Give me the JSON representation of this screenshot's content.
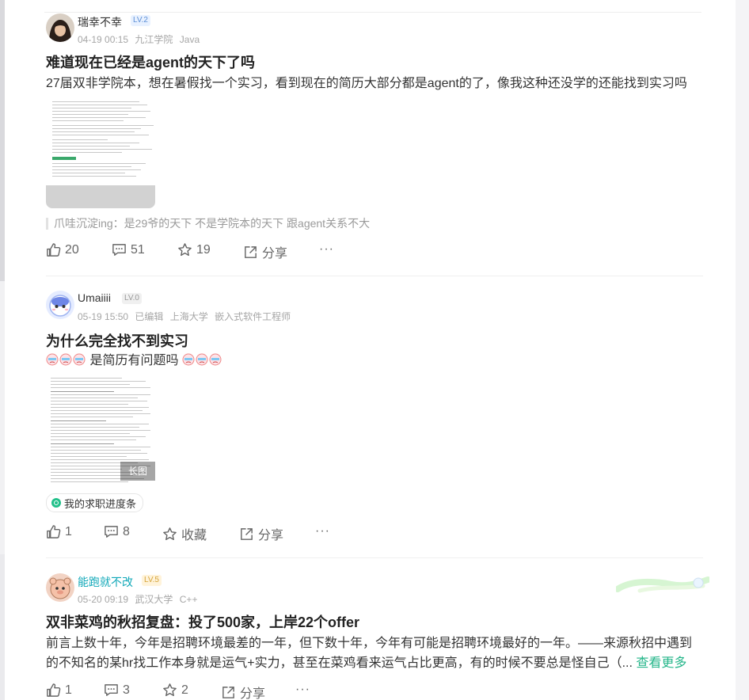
{
  "posts": [
    {
      "username": "瑞幸不幸",
      "level": "LV.2",
      "time": "04-19 00:15",
      "school": "九江学院",
      "job": "Java",
      "title": "难道现在已经是agent的天下了吗",
      "body": "27届双非学院本，想在暑假找一个实习，看到现在的简历大部分都是agent的了，像我这种还没学的还能找到实习吗",
      "comment_preview": "爪哇沉淀ing：是29爷的天下 不是学院本的天下 跟agent关系不大",
      "likes": "20",
      "comments": "51",
      "favorites": "19",
      "share_label": "分享",
      "more": "···"
    },
    {
      "username": "Umaiiii",
      "level": "LV.0",
      "time": "05-19 15:50",
      "edited": "已编辑",
      "school": "上海大学",
      "job": "嵌入式软件工程师",
      "title": "为什么完全找不到实习",
      "body_text": "是简历有问题吗",
      "long_image_label": "长图",
      "tag": "我的求职进度条",
      "likes": "1",
      "comments": "8",
      "favorites_label": "收藏",
      "share_label": "分享",
      "more": "···"
    },
    {
      "username": "能跑就不改",
      "level": "LV.5",
      "time": "05-20 09:19",
      "school": "武汉大学",
      "job": "C++",
      "title": "双非菜鸡的秋招复盘：投了500家，上岸22个offer",
      "body_line1": "前言上数十年，今年是招聘环境最差的一年，但下数十年，今年有可能是招聘环境最好的一年。——来源秋招中遇到",
      "body_line2": "的不知名的某hr找工作本身就是运气+实力，甚至在菜鸡看来运气占比更高，有的时候不要总是怪自己（...",
      "see_more": "查看更多",
      "likes": "1",
      "comments": "3",
      "favorites": "2",
      "share_label": "分享",
      "more": "···"
    }
  ],
  "colors": {
    "accent_green": "#25b68a",
    "level_blue": "#5c8fd6",
    "level_gold": "#d5a43a",
    "special_username": "#11a8b8"
  },
  "icons": [
    "thumb-up-icon",
    "comment-icon",
    "star-icon",
    "share-icon",
    "more-icon"
  ]
}
